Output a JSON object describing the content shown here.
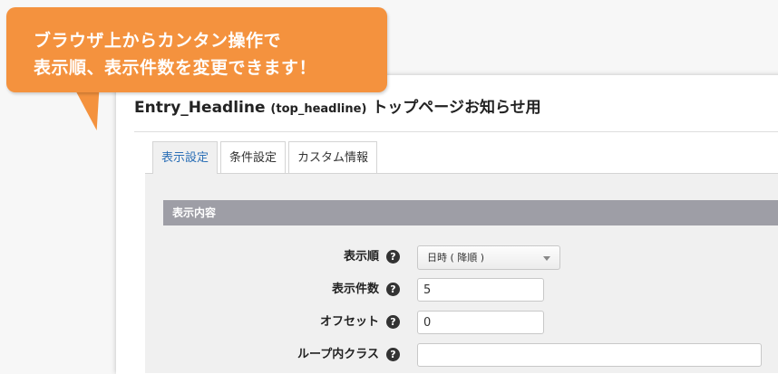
{
  "callout": {
    "line1": "ブラウザ上からカンタン操作で",
    "line2": "表示順、表示件数を変更できます！"
  },
  "header": {
    "title": "Entry_Headline",
    "module_id": "(top_headline)",
    "description": "トップページお知らせ用"
  },
  "tabs": [
    {
      "label": "表示設定",
      "active": true
    },
    {
      "label": "条件設定",
      "active": false
    },
    {
      "label": "カスタム情報",
      "active": false
    }
  ],
  "section": {
    "title": "表示内容"
  },
  "fields": {
    "order": {
      "label": "表示順",
      "value": "日時 ( 降順 )"
    },
    "limit": {
      "label": "表示件数",
      "value": "5"
    },
    "offset": {
      "label": "オフセット",
      "value": "0"
    },
    "loop_class": {
      "label": "ループ内クラス",
      "value": ""
    }
  },
  "help_glyph": "?",
  "colors": {
    "callout": "#f4923e",
    "section_header": "#9e9ea6",
    "active_tab_text": "#2b6fb6"
  }
}
